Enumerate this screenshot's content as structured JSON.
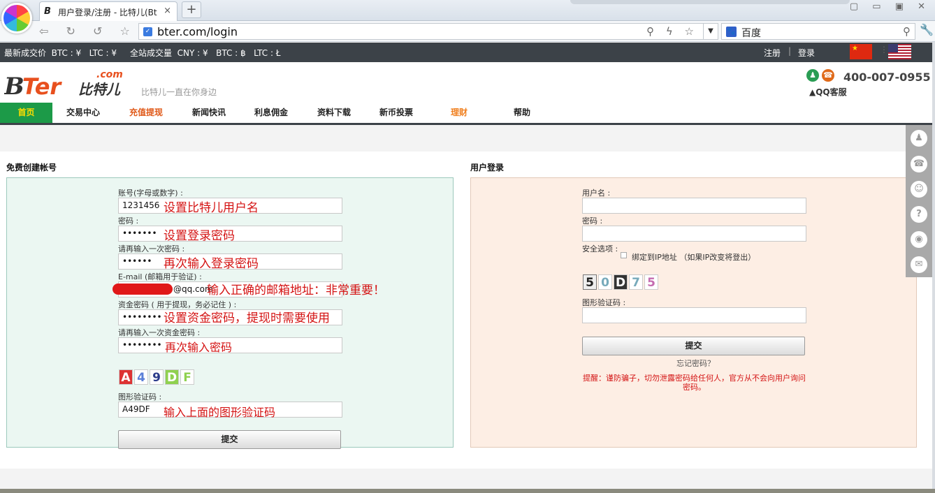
{
  "browser": {
    "tab_title": "用户登录/注册 - 比特儿(Bt",
    "tab_close": "×",
    "new_tab": "+",
    "window_controls": "▢ ▭ ▣ ✕",
    "url": "bter.com/login",
    "search_engine": "百度",
    "nav_icons": "⇦ ↻ ↺ ☆ ⊞"
  },
  "ticker": {
    "text": "最新成交价  BTC : ¥   LTC : ¥     全站成交量  CNY : ¥   BTC : ฿   LTC : Ł",
    "register": "注册",
    "separator": "|",
    "login": "登录"
  },
  "header": {
    "logo_main": "BTer",
    "logo_com": ".com",
    "logo_cn": "比特儿",
    "slogan": "比特儿一直在你身边",
    "phone": "400-007-0955",
    "qq_service": "▲QQ客服"
  },
  "menu": [
    {
      "label": "首页",
      "color": "#ffde00"
    },
    {
      "label": "交易中心",
      "color": "#222222"
    },
    {
      "label": "充值提现",
      "color": "#e05a1a"
    },
    {
      "label": "新闻快讯",
      "color": "#222222"
    },
    {
      "label": "利息佣金",
      "color": "#222222"
    },
    {
      "label": "资料下载",
      "color": "#222222"
    },
    {
      "label": "新币投票",
      "color": "#222222"
    },
    {
      "label": "理财",
      "color": "#f08020"
    },
    {
      "label": "帮助",
      "color": "#222222"
    }
  ],
  "register": {
    "title": "免费创建帐号",
    "account_label": "账号(字母或数字) :",
    "account_value": "1231456",
    "account_note": "设置比特儿用户名",
    "password_label": "密码 :",
    "password_value": "•••••••",
    "password_note": "设置登录密码",
    "password2_label": "请再输入一次密码 :",
    "password2_value": "••••••",
    "password2_note": "再次输入登录密码",
    "email_label": "E-mail (邮箱用于验证) :",
    "email_value": "@qq.com",
    "email_note": "输入正确的邮箱地址：非常重要！",
    "fund_label": "资金密码 ( 用于提现，务必记住 ) :",
    "fund_value": "••••••••",
    "fund_note": "设置资金密码，提现时需要使用",
    "fund2_label": "请再输入一次资金密码 :",
    "fund2_value": "••••••••",
    "fund2_note": "再次输入密码",
    "captcha_chars": [
      "A",
      "4",
      "9",
      "D",
      "F"
    ],
    "captcha_label": "图形验证码 :",
    "captcha_value": "A49DF",
    "captcha_note": "输入上面的图形验证码",
    "submit": "提交"
  },
  "login": {
    "title": "用户登录",
    "username_label": "用户名 :",
    "password_label": "密码 :",
    "security_label": "安全选项 :",
    "bind_ip": "绑定到IP地址 （如果IP改变将登出）",
    "captcha_chars": [
      "5",
      "0",
      "D",
      "7",
      "5"
    ],
    "captcha_label": "图形验证码 :",
    "submit": "提交",
    "forgot": "忘记密码？",
    "warning": "提醒：谨防骗子，切勿泄露密码给任何人，官方从不会向用户询问密码。"
  },
  "side_tools": [
    {
      "icon": "qq-icon",
      "glyph": "♟"
    },
    {
      "icon": "phone-icon",
      "glyph": "☎"
    },
    {
      "icon": "service-icon",
      "glyph": "☺"
    },
    {
      "icon": "help-icon",
      "glyph": "?"
    },
    {
      "icon": "weibo-icon",
      "glyph": "◉"
    },
    {
      "icon": "wechat-icon",
      "glyph": "✉"
    }
  ],
  "colors": {
    "ticker_bg": "#3c4248",
    "home_tab": "#1c9a48",
    "annotation": "#d41414",
    "register_bg": "#ebf7f2",
    "login_bg": "#fdeee4"
  }
}
